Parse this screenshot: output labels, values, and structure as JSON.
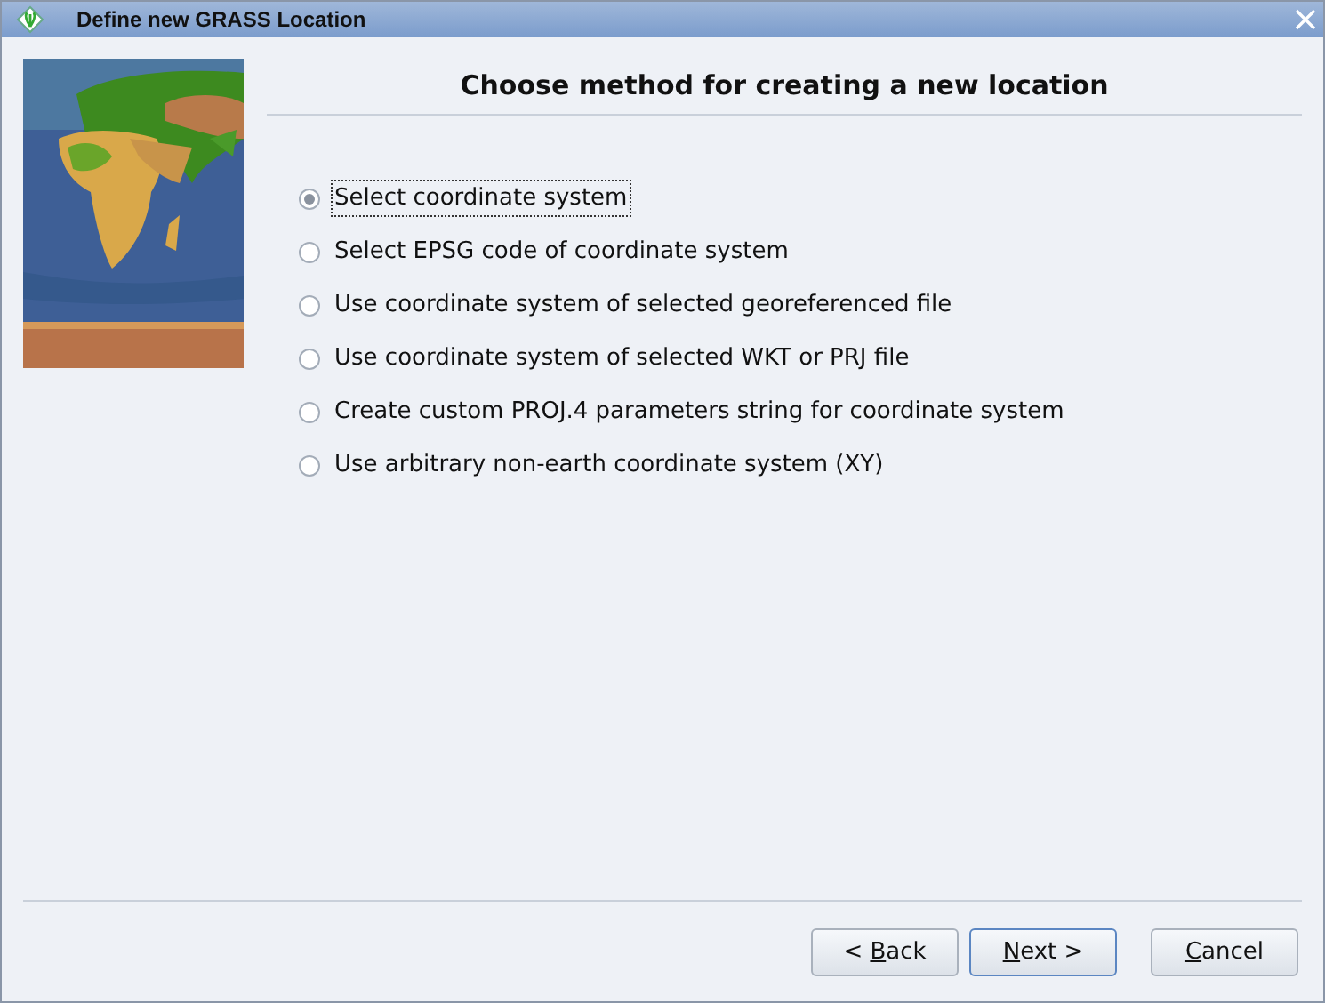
{
  "window": {
    "title": "Define new GRASS Location"
  },
  "heading": "Choose method for creating a new location",
  "options": [
    {
      "label": "Select coordinate system",
      "selected": true,
      "focused": true
    },
    {
      "label": "Select EPSG code of coordinate system",
      "selected": false,
      "focused": false
    },
    {
      "label": "Use coordinate system of selected georeferenced file",
      "selected": false,
      "focused": false
    },
    {
      "label": "Use coordinate system of selected WKT or PRJ file",
      "selected": false,
      "focused": false
    },
    {
      "label": "Create custom PROJ.4 parameters string for coordinate system",
      "selected": false,
      "focused": false
    },
    {
      "label": "Use arbitrary non-earth coordinate system (XY)",
      "selected": false,
      "focused": false
    }
  ],
  "buttons": [
    {
      "before": "< ",
      "mnemonic": "B",
      "after": "ack",
      "default": false
    },
    {
      "mnemonic": "N",
      "after": "ext >",
      "default": true
    },
    {
      "mnemonic": "C",
      "after": "ancel",
      "default": false
    }
  ]
}
